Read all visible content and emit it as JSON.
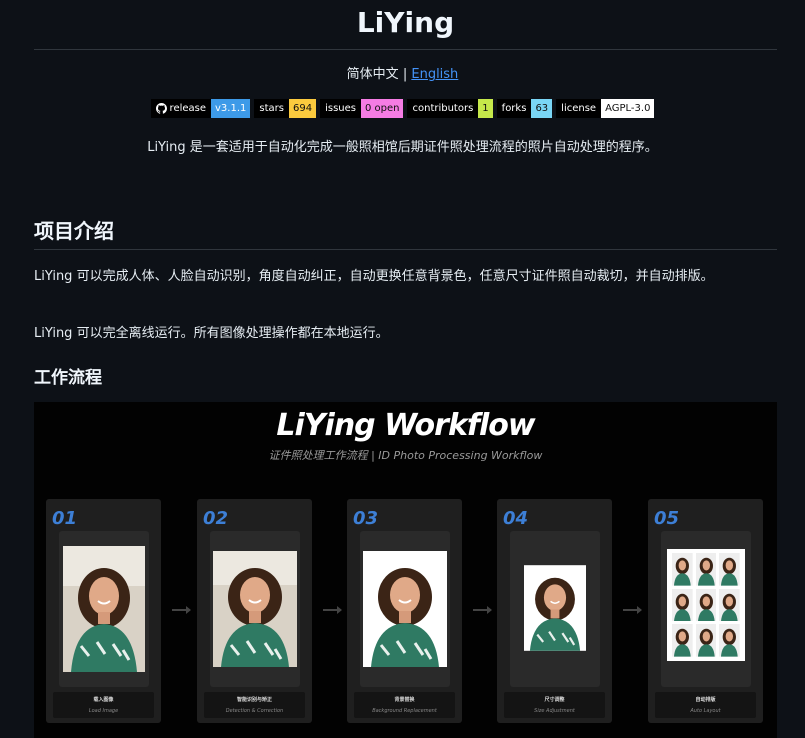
{
  "title": "LiYing",
  "lang": {
    "current": "简体中文",
    "separator": "|",
    "english": "English"
  },
  "badges": [
    {
      "label": "release",
      "value": "v3.1.1",
      "color": "#3d9ae8",
      "icon": "github-icon"
    },
    {
      "label": "stars",
      "value": "694",
      "color": "#fbca3e"
    },
    {
      "label": "issues",
      "value": "0 open",
      "color": "#f57ce4"
    },
    {
      "label": "contributors",
      "value": "1",
      "color": "#c5e84a"
    },
    {
      "label": "forks",
      "value": "63",
      "color": "#7ad6f5"
    },
    {
      "label": "license",
      "value": "AGPL-3.0",
      "color": "#ffffff"
    }
  ],
  "intro": "LiYing 是一套适用于自动化完成一般照相馆后期证件照处理流程的照片自动处理的程序。",
  "section_intro": {
    "heading": "项目介绍",
    "p1": "LiYing 可以完成人体、人脸自动识别，角度自动纠正，自动更换任意背景色，任意尺寸证件照自动裁切，并自动排版。",
    "p2": "LiYing 可以完全离线运行。所有图像处理操作都在本地运行。"
  },
  "workflow": {
    "heading": "工作流程",
    "image_title": "LiYing Workflow",
    "image_subtitle": "证件照处理工作流程 | ID Photo Processing Workflow",
    "accent": "#3d7fd6",
    "steps": [
      {
        "num": "01",
        "cn": "载入图像",
        "en": "Load Image"
      },
      {
        "num": "02",
        "cn": "智能识别与矫正",
        "en": "Detection & Correction"
      },
      {
        "num": "03",
        "cn": "背景替换",
        "en": "Background Replacement"
      },
      {
        "num": "04",
        "cn": "尺寸调整",
        "en": "Size Adjustment"
      },
      {
        "num": "05",
        "cn": "自动排版",
        "en": "Auto Layout"
      }
    ]
  }
}
